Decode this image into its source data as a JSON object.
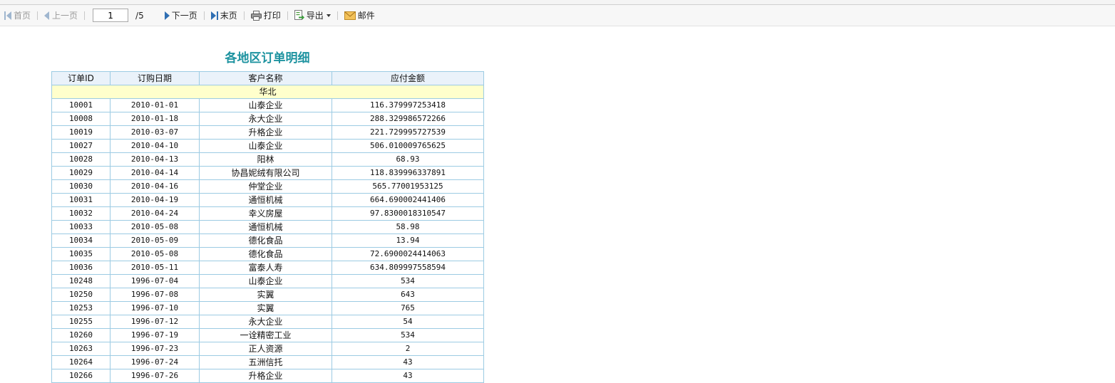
{
  "toolbar": {
    "first_label": "首页",
    "prev_label": "上一页",
    "page_value": "1",
    "page_total": "/5",
    "next_label": "下一页",
    "last_label": "末页",
    "print_label": "打印",
    "export_label": "导出",
    "mail_label": "邮件"
  },
  "report": {
    "title": "各地区订单明细",
    "headers": [
      "订单ID",
      "订购日期",
      "客户名称",
      "应付金额"
    ],
    "region": "华北",
    "rows": [
      [
        "10001",
        "2010-01-01",
        "山泰企业",
        "116.379997253418"
      ],
      [
        "10008",
        "2010-01-18",
        "永大企业",
        "288.329986572266"
      ],
      [
        "10019",
        "2010-03-07",
        "升格企业",
        "221.729995727539"
      ],
      [
        "10027",
        "2010-04-10",
        "山泰企业",
        "506.010009765625"
      ],
      [
        "10028",
        "2010-04-13",
        "阳林",
        "68.93"
      ],
      [
        "10029",
        "2010-04-14",
        "协昌妮绒有限公司",
        "118.839996337891"
      ],
      [
        "10030",
        "2010-04-16",
        "仲堂企业",
        "565.77001953125"
      ],
      [
        "10031",
        "2010-04-19",
        "通恒机械",
        "664.690002441406"
      ],
      [
        "10032",
        "2010-04-24",
        "幸义房屋",
        "97.8300018310547"
      ],
      [
        "10033",
        "2010-05-08",
        "通恒机械",
        "58.98"
      ],
      [
        "10034",
        "2010-05-09",
        "德化食品",
        "13.94"
      ],
      [
        "10035",
        "2010-05-08",
        "德化食品",
        "72.6900024414063"
      ],
      [
        "10036",
        "2010-05-11",
        "富泰人寿",
        "634.809997558594"
      ],
      [
        "10248",
        "1996-07-04",
        "山泰企业",
        "534"
      ],
      [
        "10250",
        "1996-07-08",
        "实翼",
        "643"
      ],
      [
        "10253",
        "1996-07-10",
        "实翼",
        "765"
      ],
      [
        "10255",
        "1996-07-12",
        "永大企业",
        "54"
      ],
      [
        "10260",
        "1996-07-19",
        "一诠精密工业",
        "534"
      ],
      [
        "10263",
        "1996-07-23",
        "正人资源",
        "2"
      ],
      [
        "10264",
        "1996-07-24",
        "五洲信托",
        "43"
      ],
      [
        "10266",
        "1996-07-26",
        "升格企业",
        "43"
      ]
    ]
  }
}
